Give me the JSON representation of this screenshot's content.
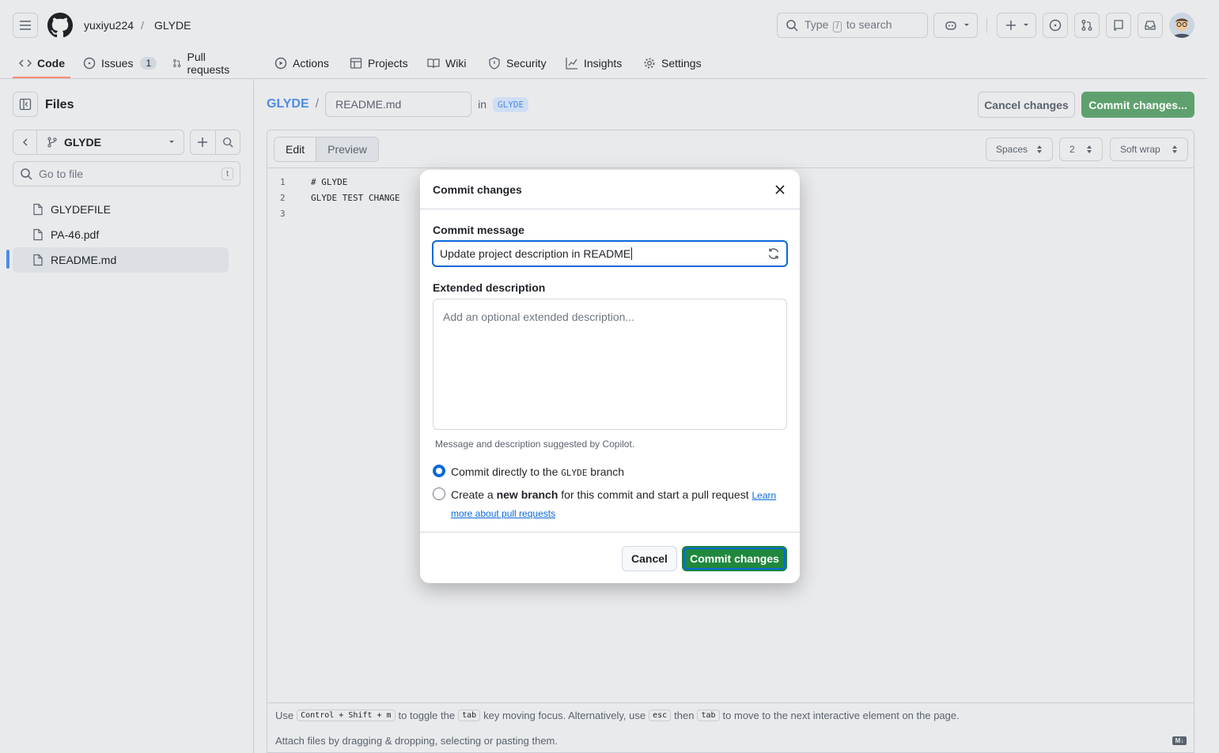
{
  "header": {
    "owner": "yuxiyu224",
    "separator": "/",
    "repo": "GLYDE",
    "search_placeholder": "Type",
    "search_key": "/",
    "search_suffix": "to search"
  },
  "tabs": [
    {
      "label": "Code",
      "icon": "code-icon"
    },
    {
      "label": "Issues",
      "icon": "issue-icon",
      "count": "1"
    },
    {
      "label": "Pull requests",
      "icon": "pull-request-icon"
    },
    {
      "label": "Actions",
      "icon": "play-icon"
    },
    {
      "label": "Projects",
      "icon": "table-icon"
    },
    {
      "label": "Wiki",
      "icon": "book-icon"
    },
    {
      "label": "Security",
      "icon": "shield-icon"
    },
    {
      "label": "Insights",
      "icon": "graph-icon"
    },
    {
      "label": "Settings",
      "icon": "gear-icon"
    }
  ],
  "sidebar": {
    "title": "Files",
    "branch": "GLYDE",
    "goto_placeholder": "Go to file",
    "goto_key": "t",
    "files": [
      {
        "name": "GLYDEFILE"
      },
      {
        "name": "PA-46.pdf"
      },
      {
        "name": "README.md",
        "active": true
      }
    ]
  },
  "editor_header": {
    "repo": "GLYDE",
    "sep": "/",
    "filename": "README.md",
    "in": "in",
    "branch": "GLYDE",
    "cancel_label": "Cancel changes",
    "commit_label": "Commit changes..."
  },
  "editor": {
    "tab_edit": "Edit",
    "tab_preview": "Preview",
    "indent_mode": "Spaces",
    "indent_size": "2",
    "wrap_mode": "Soft wrap",
    "lines": [
      {
        "n": "1",
        "text": "# GLYDE"
      },
      {
        "n": "2",
        "text": "GLYDE TEST CHANGE"
      },
      {
        "n": "3",
        "text": ""
      }
    ],
    "footer_use": "Use",
    "footer_keys": "Control + Shift + m",
    "footer_mid1": "to toggle the",
    "footer_tab": "tab",
    "footer_mid2": "key moving focus. Alternatively, use",
    "footer_esc": "esc",
    "footer_then": "then",
    "footer_tab2": "tab",
    "footer_end": "to move to the next interactive element on the page.",
    "attach": "Attach files by dragging & dropping, selecting or pasting them.",
    "md_badge": "M↓"
  },
  "modal": {
    "title": "Commit changes",
    "msg_label": "Commit message",
    "msg_value": "Update project description in README",
    "desc_label": "Extended description",
    "desc_placeholder": "Add an optional extended description...",
    "hint": "Message and description suggested by Copilot.",
    "opt1_pre": "Commit directly to the",
    "opt1_branch": "GLYDE",
    "opt1_post": "branch",
    "opt2_pre": "Create a",
    "opt2_bold": "new branch",
    "opt2_post": "for this commit and start a pull request",
    "opt2_link": "Learn more about pull requests",
    "cancel": "Cancel",
    "commit": "Commit changes"
  }
}
